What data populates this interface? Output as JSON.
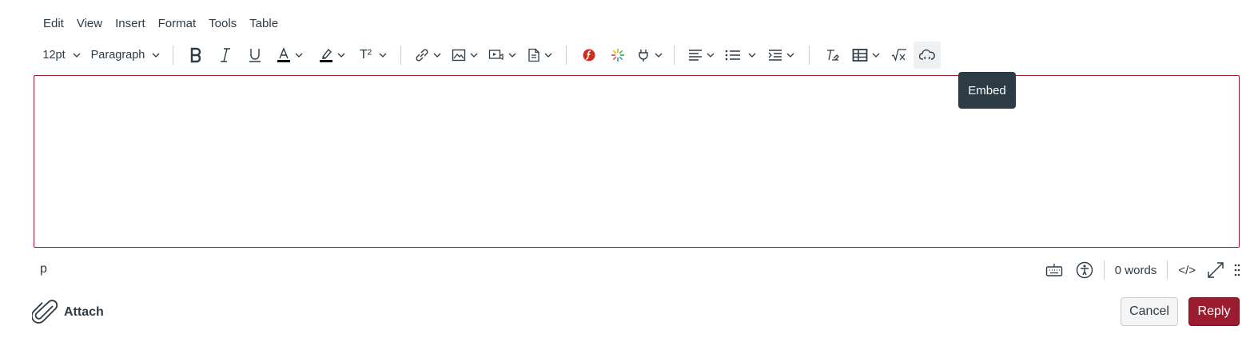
{
  "menubar": {
    "items": [
      "Edit",
      "View",
      "Insert",
      "Format",
      "Tools",
      "Table"
    ]
  },
  "toolbar": {
    "font_size": "12pt",
    "block_format": "Paragraph",
    "superscript_label": "T²",
    "icons": [
      "bold-icon",
      "italic-icon",
      "underline-icon",
      "text-color-icon",
      "highlight-icon",
      "superscript-icon",
      "link-icon",
      "image-icon",
      "media-icon",
      "document-icon",
      "flash-icon",
      "apps-icon",
      "plugin-icon",
      "align-icon",
      "bullet-list-icon",
      "indent-icon",
      "clear-format-icon",
      "table-icon",
      "math-icon",
      "embed-icon"
    ],
    "text_color": "#000000",
    "highlight_color": "#000000"
  },
  "tooltip": {
    "text": "Embed"
  },
  "statusbar": {
    "path": "p",
    "word_count": "0 words",
    "html_toggle": "</>"
  },
  "footer": {
    "attach_label": "Attach",
    "cancel_label": "Cancel",
    "reply_label": "Reply"
  },
  "colors": {
    "accent": "#9b1c2e",
    "text": "#2d3b45",
    "tooltip_bg": "#2d3b45",
    "flash": "#d52b1e"
  }
}
